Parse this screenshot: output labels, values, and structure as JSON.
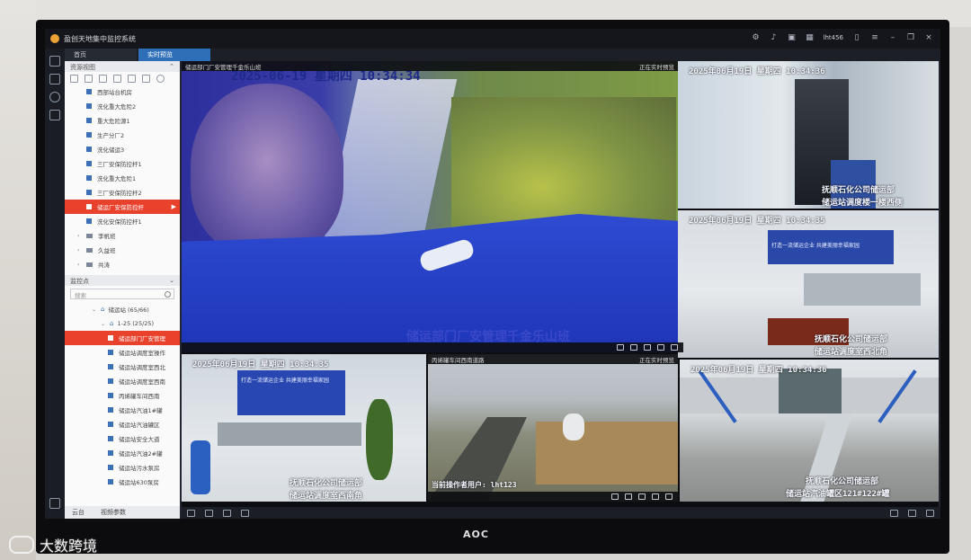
{
  "app": {
    "title": "盈创天地集中监控系统",
    "user": "lht456",
    "tabs": [
      {
        "label": "首页",
        "active": false
      },
      {
        "label": "实时预览",
        "active": true
      }
    ]
  },
  "left_panel": {
    "resource_header": "资源视图",
    "resource_items": [
      {
        "label": "西部站台机房",
        "selected": false
      },
      {
        "label": "洗化重大危险2",
        "selected": false
      },
      {
        "label": "重大危险源1",
        "selected": false
      },
      {
        "label": "生产分厂2",
        "selected": false
      },
      {
        "label": "洗化储运3",
        "selected": false
      },
      {
        "label": "三厂安保防控杆1",
        "selected": false
      },
      {
        "label": "洗化重大危险1",
        "selected": false
      },
      {
        "label": "三厂安保防控杆2",
        "selected": false
      },
      {
        "label": "储运厂安保防控杆",
        "selected": true
      },
      {
        "label": "洗化安保防控杆1",
        "selected": false
      }
    ],
    "groups": [
      "李帆班",
      "久益班",
      "共涛"
    ],
    "monitor_header": "监控点",
    "search_placeholder": "搜索",
    "monitor_tree": [
      {
        "label": "储运站 (65/66)",
        "kind": "root"
      },
      {
        "label": "1-25 (25/25)",
        "kind": "branch"
      },
      {
        "label": "储运部门厂安管理",
        "kind": "cam",
        "selected": true
      },
      {
        "label": "储运站调度室操作",
        "kind": "cam"
      },
      {
        "label": "储运站调度室西北",
        "kind": "cam"
      },
      {
        "label": "储运站调度室西南",
        "kind": "cam"
      },
      {
        "label": "丙烯罐车间西南",
        "kind": "cam"
      },
      {
        "label": "储运站汽油1#罐",
        "kind": "cam"
      },
      {
        "label": "储运站汽油罐区",
        "kind": "cam"
      },
      {
        "label": "储运站安全大道",
        "kind": "cam"
      },
      {
        "label": "储运站汽油2#罐",
        "kind": "cam"
      },
      {
        "label": "储运站污水泵房",
        "kind": "cam"
      },
      {
        "label": "储运站630泵房",
        "kind": "cam"
      }
    ],
    "footer_tabs": [
      "云台",
      "视频参数"
    ]
  },
  "tiles": [
    {
      "title": "储运部门厂安管理千金乐山班",
      "status": "正在实时预览",
      "osd_time": "2025-06-19  星期四  10:34:34",
      "caption": "储运部门厂安管理千金乐山班"
    },
    {
      "title": "",
      "status": "",
      "osd_time": "2025年06月19日  星期四  10:34:36",
      "caption_line1": "抚顺石化公司储运部",
      "caption_line2": "储运站调度楼一楼西侧"
    },
    {
      "title": "",
      "status": "",
      "osd_time": "2025年06月19日  星期四  10:34:35",
      "caption_line1": "抚顺石化公司储运部",
      "caption_line2": "储运站调度室西北角"
    },
    {
      "title": "",
      "status": "",
      "osd_time": "2025年06月19日  星期四  10:34:35",
      "caption_line1": "抚顺石化公司储运部",
      "caption_line2": "储运站调度室西南角",
      "banner": "打造一流储运企业  共建美丽幸福家园"
    },
    {
      "title": "丙烯罐车间西南道路",
      "status": "正在实时预览",
      "osd_time": "",
      "caption": "当前操作者用户: lht123"
    },
    {
      "title": "",
      "status": "",
      "osd_time": "2025年06月19日  星期四  10:34:36",
      "caption_line1": "抚顺石化公司储运部",
      "caption_line2": "储运站汽油罐区121#122#罐"
    }
  ],
  "banner_text": "打造一流储运企业  共建美丽幸福家园",
  "bezel_brand": "AOC",
  "watermark": "大数跨境",
  "colors": {
    "accent": "#2f6fb8",
    "selected": "#e8412c",
    "titlebar": "#14161b"
  }
}
